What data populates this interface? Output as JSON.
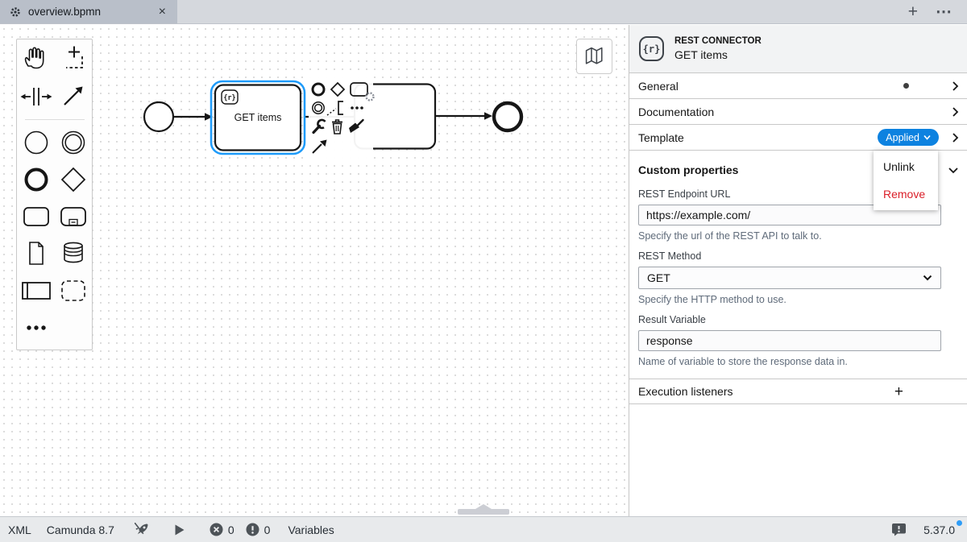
{
  "tab_bar": {
    "tab": {
      "title": "overview.bpmn",
      "close_glyph": "×"
    },
    "new_tab_glyph": "+",
    "overflow_glyph": "⋯"
  },
  "palette": {
    "tools": [
      "hand-tool",
      "lasso-tool",
      "space-tool",
      "global-connect-tool"
    ],
    "elements": [
      "start-event",
      "intermediate-event",
      "end-event",
      "gateway",
      "task",
      "subprocess",
      "data-object",
      "data-store",
      "participant",
      "group"
    ],
    "more_glyph": "⋯"
  },
  "diagram": {
    "task_label": "GET items",
    "task_badge": "{r}",
    "context_pad_icons": [
      "append-end-event",
      "append-gateway",
      "append-task",
      "append-gear",
      "append-intermediate-event",
      "append-text-annotation",
      "more-options",
      "change-type-wrench",
      "delete-trash",
      "set-color-brush",
      "connect-arrow"
    ]
  },
  "panel": {
    "header": {
      "badge": "{r}",
      "kind": "REST CONNECTOR",
      "element_name": "GET items"
    },
    "rows": {
      "general": "General",
      "documentation": "Documentation",
      "template": "Template",
      "custom_properties": "Custom properties",
      "execution_listeners": "Execution listeners",
      "add_glyph": "+"
    },
    "template": {
      "status_label": "Applied",
      "menu": {
        "unlink": "Unlink",
        "remove": "Remove"
      }
    },
    "fields": {
      "endpoint_label": "REST Endpoint URL",
      "endpoint_value": "https://example.com/",
      "endpoint_help": "Specify the url of the REST API to talk to.",
      "method_label": "REST Method",
      "method_value": "GET",
      "method_help": "Specify the HTTP method to use.",
      "result_label": "Result Variable",
      "result_value": "response",
      "result_help": "Name of variable to store the response data in."
    }
  },
  "status_bar": {
    "xml_label": "XML",
    "engine_label": "Camunda 8.7",
    "error_count": "0",
    "warning_count": "0",
    "variables_label": "Variables",
    "version": "5.37.0"
  },
  "colors": {
    "selection_blue": "#1e9bfa",
    "template_pill_blue": "#0d82e0",
    "remove_red": "#da1e28",
    "update_dot_blue": "#2e9df7",
    "statusbar_icon_gray": "#4d5358"
  }
}
